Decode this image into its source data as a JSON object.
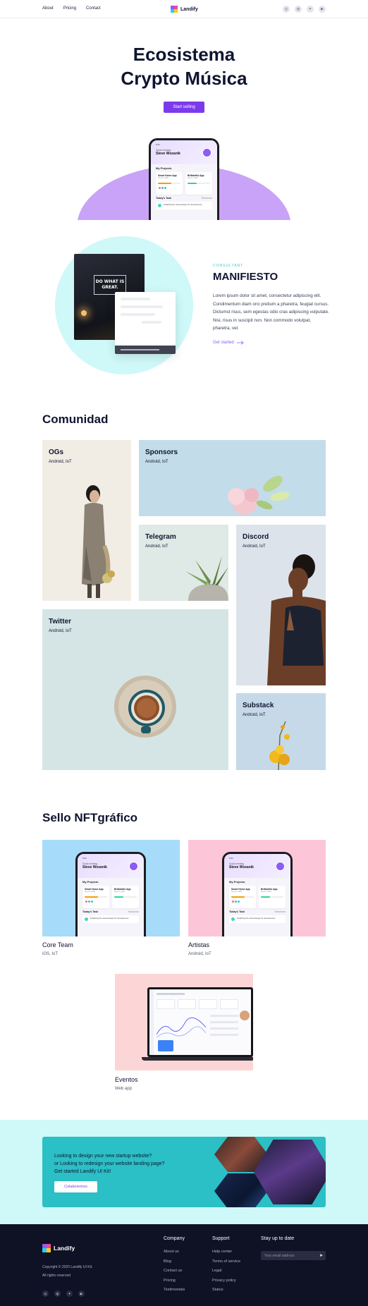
{
  "nav": {
    "links": [
      "About",
      "Pricing",
      "Contact"
    ],
    "brand": "Landify",
    "social_icons": [
      "instagram-icon",
      "dribbble-icon",
      "twitter-icon",
      "youtube-icon"
    ]
  },
  "hero": {
    "title_line1": "Ecosistema",
    "title_line2": "Crypto Música",
    "cta": "Start selling"
  },
  "phone_app": {
    "time": "9:41",
    "greeting": "Good evening",
    "name": "Steve Wozanik",
    "projects_heading": "My Projects",
    "card1_title": "Smart Home App",
    "card1_sub": "Aug 10, 2020",
    "card1_progress": 0.6,
    "card1_percent": "60%",
    "card2_title": "Brilliantful App",
    "card2_sub": "Aug 10, 2020",
    "task_heading": "Today's Task",
    "task_side": "Tomorrow",
    "task_text": "Finalizing the visual design for development"
  },
  "manifiesto": {
    "label": "CONSULTANT",
    "title": "MANIFIESTO",
    "text": "Lorem ipsum dolor sit amet, consectetur adipiscing elit. Condimentum diam orci pretium a pharetra, feugiat cursus. Dictumst risus, sem egestas odio cras adipiscing vulputate. Nisi, risus in suscipit non. Non commodo volutpat, pharetra, vel.",
    "link": "Get started",
    "sign_text": "DO WHAT IS GREAT."
  },
  "comunidad": {
    "title": "Comunidad",
    "tiles": [
      {
        "title": "OGs",
        "sub": "Android, IoT"
      },
      {
        "title": "Sponsors",
        "sub": "Android, IoT"
      },
      {
        "title": "Telegram",
        "sub": "Android, IoT"
      },
      {
        "title": "Discord",
        "sub": "Android, IoT"
      },
      {
        "title": "Twitter",
        "sub": "Android, IoT"
      },
      {
        "title": "Substack",
        "sub": "Android, IoT"
      }
    ]
  },
  "sello": {
    "title": "Sello NFTgráfico",
    "cards": [
      {
        "title": "Core Team",
        "sub": "iOS, IoT"
      },
      {
        "title": "Artistas",
        "sub": "Android, IoT"
      },
      {
        "title": "Eventos",
        "sub": "Web app"
      }
    ]
  },
  "cta": {
    "line1": "Looking to design your new startup website?",
    "line2": "or Looking to redesign your website landing page?",
    "line3": "Get started Landify UI Kit!",
    "button": "Colaboremos"
  },
  "footer": {
    "brand": "Landify",
    "copyright": "Copyright © 2020 Landify UI Kit.",
    "rights": "All rights reserved",
    "company_heading": "Company",
    "company_links": [
      "About us",
      "Blog",
      "Contact us",
      "Pricing",
      "Testimonials"
    ],
    "support_heading": "Support",
    "support_links": [
      "Help center",
      "Terms of service",
      "Legal",
      "Privacy policy",
      "Status"
    ],
    "newsletter_heading": "Stay up to date",
    "email_placeholder": "Your email address"
  },
  "colors": {
    "primary": "#7c3aed",
    "accent_teal": "#2bbfc6",
    "hero_arc": "#c9a3f7",
    "light_cyan": "#cff8f8",
    "footer_bg": "#0f1124"
  }
}
